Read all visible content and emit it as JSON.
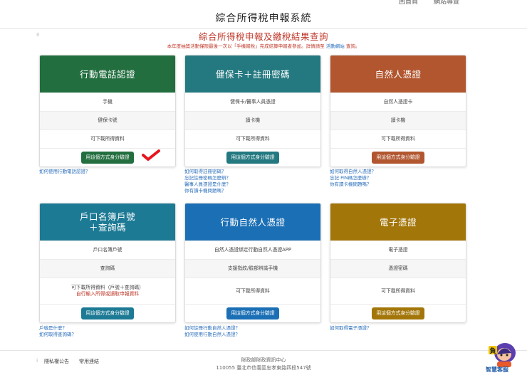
{
  "topnav": {
    "home": "回首頁",
    "sitemap": "網站導覽"
  },
  "site_title": "綜合所得稅申報系統",
  "sub_title": "綜合所得稅申報及繳稅結果查詢",
  "notice": {
    "text": "本年度抽獎活動僅限最後一次以「手機報稅」完成結算申報者參加。詳情請至",
    "link": "活動網站",
    "suffix": "查詢。"
  },
  "button_label": "用這個方式身分驗證",
  "cards": [
    {
      "title": "行動電話認證",
      "color": "#226e3f",
      "rows": [
        "手機",
        "健保卡號",
        "可下載所得資料"
      ],
      "links": [
        "如何使用行動電話認證？"
      ]
    },
    {
      "title": "健保卡＋註冊密碼",
      "color": "#247980",
      "rows": [
        "健保卡/醫事人員憑證",
        "讀卡機",
        "可下載所得資料"
      ],
      "links": [
        "如何取得註冊密碼？",
        "忘記註冊密碼怎麼辦？",
        "醫事人員憑證是什麼？",
        "你有讀卡機問題嗎？"
      ]
    },
    {
      "title": "自然人憑證",
      "color": "#b1562f",
      "rows": [
        "自然人憑證卡",
        "讀卡機",
        "可下載所得資料"
      ],
      "links": [
        "如何取得自然人憑證？",
        "忘記 PIN碼怎麼辦？",
        "你有讀卡機問題嗎？"
      ]
    },
    {
      "title_line1": "戶口名簿戶號",
      "title_line2": "＋查詢碼",
      "color": "#1d7a95",
      "rows": [
        "戶口名簿戶號",
        "查詢碼"
      ],
      "tall_line1": "可下載所得資料（戶號＋查詢碼）",
      "tall_line2": "自行輸入所得或讀取申報資料",
      "links": [
        "戶號是什麼？",
        "如何取得查詢碼？"
      ]
    },
    {
      "title": "行動自然人憑證",
      "color": "#1b6fb5",
      "rows": [
        "自然人憑證綁定行動自然人憑證APP",
        "支援指紋/臉部辨識手機",
        "可下載所得資料"
      ],
      "links": [
        "如何註冊行動自然人憑證？",
        "如何使用行動自然人憑證？"
      ]
    },
    {
      "title": "電子憑證",
      "color": "#a37609",
      "rows": [
        "電子憑證",
        "憑證密碼",
        "可下載所得資料"
      ],
      "links": [
        "如何取得電子憑證？"
      ]
    }
  ],
  "footer": {
    "privacy": "隱私權公告",
    "links": "常用連結",
    "org": "財政部財政資訊中心",
    "address": "110055 臺北市信義區忠孝東路四段547號"
  },
  "bot_label": "智慧客服",
  "icons": {
    "check": "red-check-icon",
    "bot": "chatbot-icon"
  }
}
